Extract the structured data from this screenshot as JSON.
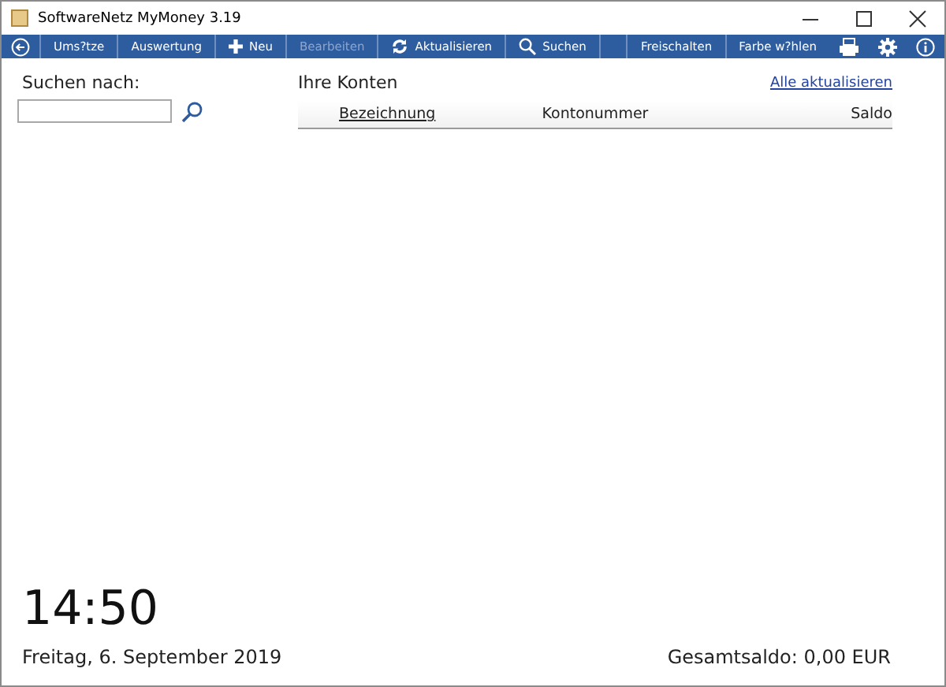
{
  "window": {
    "title": "SoftwareNetz MyMoney 3.19"
  },
  "toolbar": {
    "left": [
      {
        "kind": "back"
      },
      {
        "kind": "text",
        "label": "Ums?tze",
        "disabled": false
      },
      {
        "kind": "text",
        "label": "Auswertung",
        "disabled": false
      },
      {
        "kind": "add",
        "label": "Neu",
        "disabled": false
      },
      {
        "kind": "text",
        "label": "Bearbeiten",
        "disabled": true
      },
      {
        "kind": "refresh",
        "label": "Aktualisieren",
        "disabled": false
      },
      {
        "kind": "search",
        "label": "Suchen",
        "disabled": false
      }
    ],
    "right": [
      {
        "kind": "text",
        "label": "Freischalten",
        "disabled": false
      },
      {
        "kind": "text",
        "label": "Farbe w?hlen",
        "disabled": false
      },
      {
        "kind": "print"
      },
      {
        "kind": "settings"
      },
      {
        "kind": "info"
      }
    ]
  },
  "search": {
    "label": "Suchen nach:"
  },
  "accounts": {
    "title": "Ihre Konten",
    "refresh_link": "Alle aktualisieren",
    "columns": [
      "Bezeichnung",
      "Kontonummer",
      "Saldo"
    ]
  },
  "footer": {
    "time": "14:50",
    "date": "Freitag, 6. September 2019",
    "total": "Gesamtsaldo: 0,00 EUR"
  }
}
